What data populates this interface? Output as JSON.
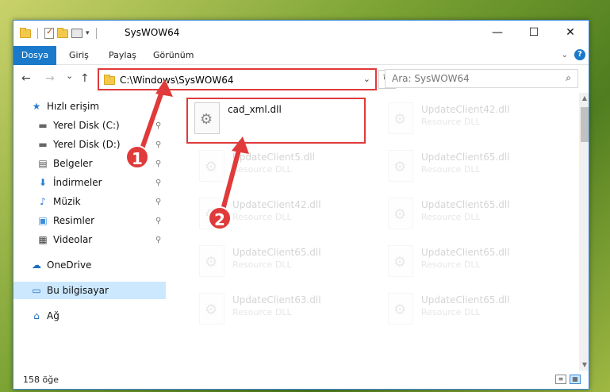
{
  "window": {
    "title": "SysWOW64",
    "controls": {
      "minimize": "—",
      "maximize": "☐",
      "close": "✕"
    }
  },
  "ribbon": {
    "tabs": [
      "Dosya",
      "Giriş",
      "Paylaş",
      "Görünüm"
    ],
    "expand_icon": "chevron-down-icon",
    "help": "?"
  },
  "navigation": {
    "back": "←",
    "forward": "→",
    "recent": "⌄",
    "up": "↑",
    "address": "C:\\Windows\\SysWOW64",
    "address_dropdown": "⌄",
    "refresh": "↻",
    "search_placeholder": "Ara: SysWOW64",
    "search_icon": "⌕"
  },
  "sidebar": {
    "items": [
      {
        "label": "Hızlı erişim",
        "icon": "star-icon",
        "glyph": "★",
        "pinned": false
      },
      {
        "label": "Yerel Disk (C:)",
        "icon": "drive-icon",
        "glyph": "▬",
        "pinned": true
      },
      {
        "label": "Yerel Disk (D:)",
        "icon": "drive-icon",
        "glyph": "▬",
        "pinned": true
      },
      {
        "label": "Belgeler",
        "icon": "documents-icon",
        "glyph": "▤",
        "pinned": true
      },
      {
        "label": "İndirmeler",
        "icon": "download-icon",
        "glyph": "⬇",
        "pinned": true
      },
      {
        "label": "Müzik",
        "icon": "music-icon",
        "glyph": "♪",
        "pinned": true
      },
      {
        "label": "Resimler",
        "icon": "pictures-icon",
        "glyph": "▣",
        "pinned": true
      },
      {
        "label": "Videolar",
        "icon": "video-icon",
        "glyph": "▦",
        "pinned": true
      },
      {
        "label": "OneDrive",
        "icon": "cloud-icon",
        "glyph": "☁",
        "pinned": false
      },
      {
        "label": "Bu bilgisayar",
        "icon": "computer-icon",
        "glyph": "▭",
        "pinned": false,
        "selected": true
      },
      {
        "label": "Ağ",
        "icon": "network-icon",
        "glyph": "⌂",
        "pinned": false
      }
    ],
    "pin_glyph": "📌"
  },
  "files": [
    {
      "name": "cad_xml.dll",
      "type": "",
      "highlighted": true
    },
    {
      "name": "UpdateClient42.dll",
      "type": "Resource DLL"
    },
    {
      "name": "UpdateClient5.dll",
      "type": "Resource DLL"
    },
    {
      "name": "UpdateClient65.dll",
      "type": "Resource DLL"
    },
    {
      "name": "UpdateClient42.dll",
      "type": "Resource DLL"
    },
    {
      "name": "UpdateClient65.dll",
      "type": "Resource DLL"
    },
    {
      "name": "UpdateClient65.dll",
      "type": "Resource DLL"
    },
    {
      "name": "UpdateClient65.dll",
      "type": "Resource DLL"
    },
    {
      "name": "UpdateClient63.dll",
      "type": "Resource DLL"
    },
    {
      "name": "UpdateClient65.dll",
      "type": "Resource DLL"
    }
  ],
  "status": {
    "item_count": "158 öğe"
  },
  "annotations": {
    "callout_1": "1",
    "callout_2": "2",
    "color": "#e03a3a"
  }
}
